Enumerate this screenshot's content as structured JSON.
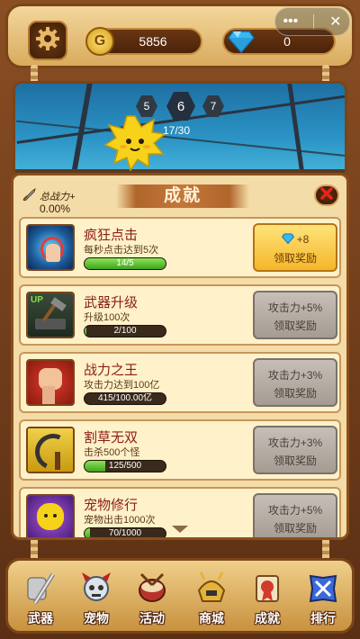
{
  "currency": {
    "coins": "5856",
    "gems": "0",
    "coin_symbol": "G"
  },
  "window_controls": {
    "more_icon": "more-dots-icon",
    "close_icon": "close-circle-icon"
  },
  "stage": {
    "prev_level": "5",
    "current_level": "6",
    "next_level": "7",
    "progress_text": "17/30"
  },
  "panel": {
    "power_label": "总战力+",
    "power_value": "0.00%",
    "title": "成就"
  },
  "achievements": [
    {
      "title": "疯狂点击",
      "desc": "每秒点击达到5次",
      "progress_text": "14/5",
      "progress": 1.0,
      "reward_top": "+8",
      "reward_label": "领取奖励",
      "state": "active",
      "icon": "click-burst-icon"
    },
    {
      "title": "武器升级",
      "desc": "升级100次",
      "progress_text": "2/100",
      "progress": 0.02,
      "reward_top": "攻击力+5%",
      "reward_label": "领取奖励",
      "state": "inactive",
      "icon": "anvil-hammer-icon",
      "icon_badge": "UP"
    },
    {
      "title": "战力之王",
      "desc": "攻击力达到100亿",
      "progress_text": "415/100.00亿",
      "progress": 0.0,
      "reward_top": "攻击力+3%",
      "reward_label": "领取奖励",
      "state": "inactive",
      "icon": "fist-icon"
    },
    {
      "title": "割草无双",
      "desc": "击杀500个怪",
      "progress_text": "125/500",
      "progress": 0.25,
      "reward_top": "攻击力+3%",
      "reward_label": "领取奖励",
      "state": "inactive",
      "icon": "sickle-icon"
    },
    {
      "title": "宠物修行",
      "desc": "宠物出击1000次",
      "progress_text": "70/1000",
      "progress": 0.07,
      "reward_top": "攻击力+5%",
      "reward_label": "领取奖励",
      "state": "inactive",
      "icon": "yellow-pet-icon"
    }
  ],
  "nav": [
    {
      "label": "武器",
      "icon": "sword-shield-icon"
    },
    {
      "label": "宠物",
      "icon": "pet-skull-icon"
    },
    {
      "label": "活动",
      "icon": "drum-icon"
    },
    {
      "label": "商城",
      "icon": "samurai-helmet-icon"
    },
    {
      "label": "成就",
      "icon": "achievement-scroll-icon"
    },
    {
      "label": "排行",
      "icon": "ranking-crossed-swords-icon"
    }
  ],
  "colors": {
    "accent_gold": "#f5b62a",
    "title_red": "#8a1f12",
    "progress_green": "#3fa41e"
  }
}
